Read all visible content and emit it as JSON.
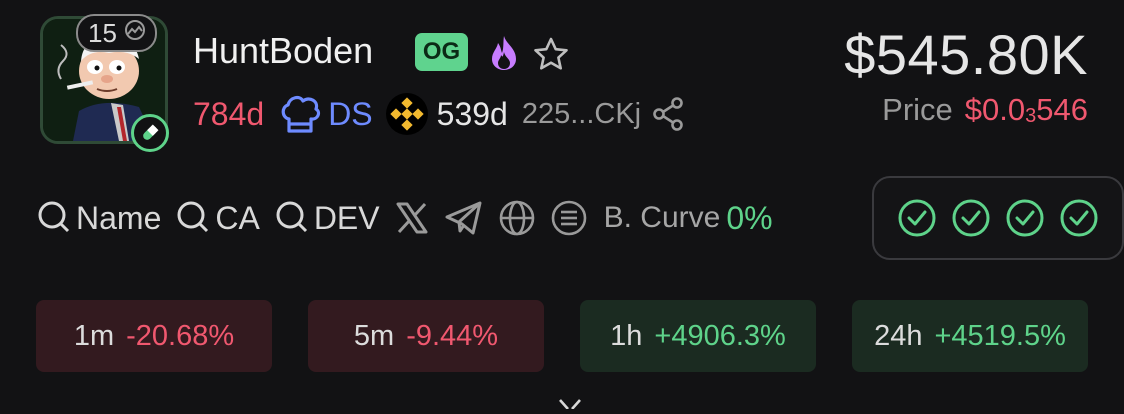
{
  "token": {
    "name": "HuntBoden",
    "og_badge": "OG",
    "holder_count": "15",
    "age": "784d",
    "ds_label": "DS",
    "bnb_age": "539d",
    "address_short": "225...CKj"
  },
  "market": {
    "market_cap": "$545.80K",
    "price_label": "Price",
    "price_prefix": "$0.0",
    "price_subscript": "3",
    "price_suffix": "546"
  },
  "links": {
    "search_name": "Name",
    "search_ca": "CA",
    "search_dev": "DEV",
    "bonding_curve_label": "B. Curve",
    "bonding_curve_value": "0%"
  },
  "checks": [
    "check-1",
    "check-2",
    "check-3",
    "check-4"
  ],
  "changes": [
    {
      "label": "1m",
      "value": "-20.68%",
      "trend": "negative"
    },
    {
      "label": "5m",
      "value": "-9.44%",
      "trend": "negative"
    },
    {
      "label": "1h",
      "value": "+4906.3%",
      "trend": "positive"
    },
    {
      "label": "24h",
      "value": "+4519.5%",
      "trend": "positive"
    }
  ],
  "colors": {
    "positive": "#5ed38a",
    "negative": "#f0586f",
    "ds_blue": "#6e8bff",
    "fire_purple": "#c77dff",
    "bnb_yellow": "#f3ba2f"
  },
  "icons": [
    "eye-off-icon",
    "pill-icon",
    "fire-icon",
    "star-icon",
    "chef-hat-icon",
    "bnb-icon",
    "share-icon",
    "search-icon",
    "x-icon",
    "telegram-icon",
    "globe-icon",
    "docs-icon",
    "check-circle-icon",
    "chevron-down-icon"
  ]
}
